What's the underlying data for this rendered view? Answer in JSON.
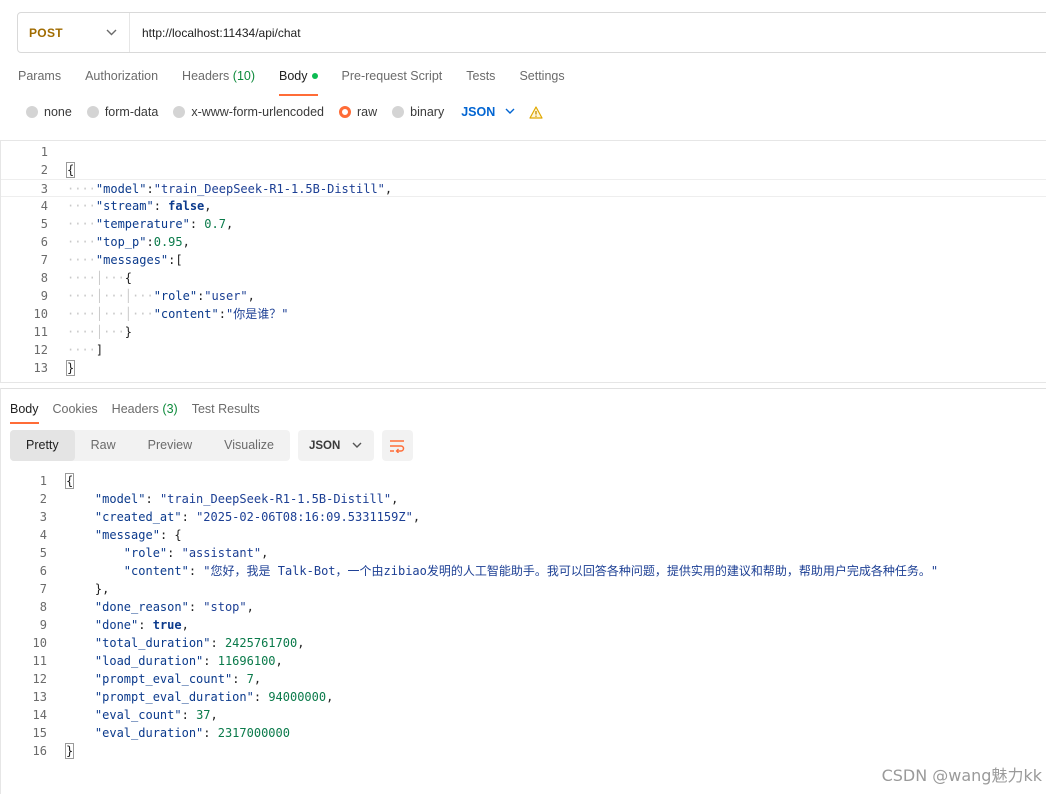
{
  "request": {
    "method": "POST",
    "url": "http://localhost:11434/api/chat"
  },
  "request_tabs": {
    "params": "Params",
    "authorization": "Authorization",
    "headers": "Headers",
    "headers_count": "(10)",
    "body": "Body",
    "pre_request": "Pre-request Script",
    "tests": "Tests",
    "settings": "Settings"
  },
  "body_types": {
    "none": "none",
    "form_data": "form-data",
    "urlencoded": "x-www-form-urlencoded",
    "raw": "raw",
    "binary": "binary",
    "format": "JSON",
    "selected": "raw"
  },
  "request_body": {
    "line_numbers": [
      "1",
      "2",
      "3",
      "4",
      "5",
      "6",
      "7",
      "8",
      "9",
      "10",
      "11",
      "12",
      "13"
    ],
    "model_key": "\"model\"",
    "model_val": "\"train_DeepSeek-R1-1.5B-Distill\"",
    "stream_key": "\"stream\"",
    "stream_val": "false",
    "temperature_key": "\"temperature\"",
    "temperature_val": "0.7",
    "top_p_key": "\"top_p\"",
    "top_p_val": "0.95",
    "messages_key": "\"messages\"",
    "role_key": "\"role\"",
    "role_val": "\"user\"",
    "content_key": "\"content\"",
    "content_val": "\"你是谁？\""
  },
  "response_tabs": {
    "body": "Body",
    "cookies": "Cookies",
    "headers": "Headers",
    "headers_count": "(3)",
    "test_results": "Test Results"
  },
  "view_modes": {
    "pretty": "Pretty",
    "raw": "Raw",
    "preview": "Preview",
    "visualize": "Visualize",
    "format": "JSON"
  },
  "response_body": {
    "line_numbers": [
      "1",
      "2",
      "3",
      "4",
      "5",
      "6",
      "7",
      "8",
      "9",
      "10",
      "11",
      "12",
      "13",
      "14",
      "15",
      "16"
    ],
    "model_key": "\"model\"",
    "model_val": "\"train_DeepSeek-R1-1.5B-Distill\"",
    "created_at_key": "\"created_at\"",
    "created_at_val": "\"2025-02-06T08:16:09.5331159Z\"",
    "message_key": "\"message\"",
    "role_key": "\"role\"",
    "role_val": "\"assistant\"",
    "content_key": "\"content\"",
    "content_val": "\"您好，我是 Talk-Bot，一个由zibiao发明的人工智能助手。我可以回答各种问题，提供实用的建议和帮助，帮助用户完成各种任务。\"",
    "done_reason_key": "\"done_reason\"",
    "done_reason_val": "\"stop\"",
    "done_key": "\"done\"",
    "done_val": "true",
    "total_duration_key": "\"total_duration\"",
    "total_duration_val": "2425761700",
    "load_duration_key": "\"load_duration\"",
    "load_duration_val": "11696100",
    "prompt_eval_count_key": "\"prompt_eval_count\"",
    "prompt_eval_count_val": "7",
    "prompt_eval_duration_key": "\"prompt_eval_duration\"",
    "prompt_eval_duration_val": "94000000",
    "eval_count_key": "\"eval_count\"",
    "eval_count_val": "37",
    "eval_duration_key": "\"eval_duration\"",
    "eval_duration_val": "2317000000"
  },
  "watermark": "CSDN @wang魅力kk",
  "icons": {
    "method_dropdown": "chevron-down-icon",
    "format_dropdown": "chevron-down-icon",
    "warning": "warning-triangle-icon",
    "wrap": "wrap-lines-icon"
  },
  "colors": {
    "accent": "#ff6c37",
    "method": "#a06b00",
    "json_blue": "#0265d2",
    "count_green": "#0d8a3b"
  }
}
